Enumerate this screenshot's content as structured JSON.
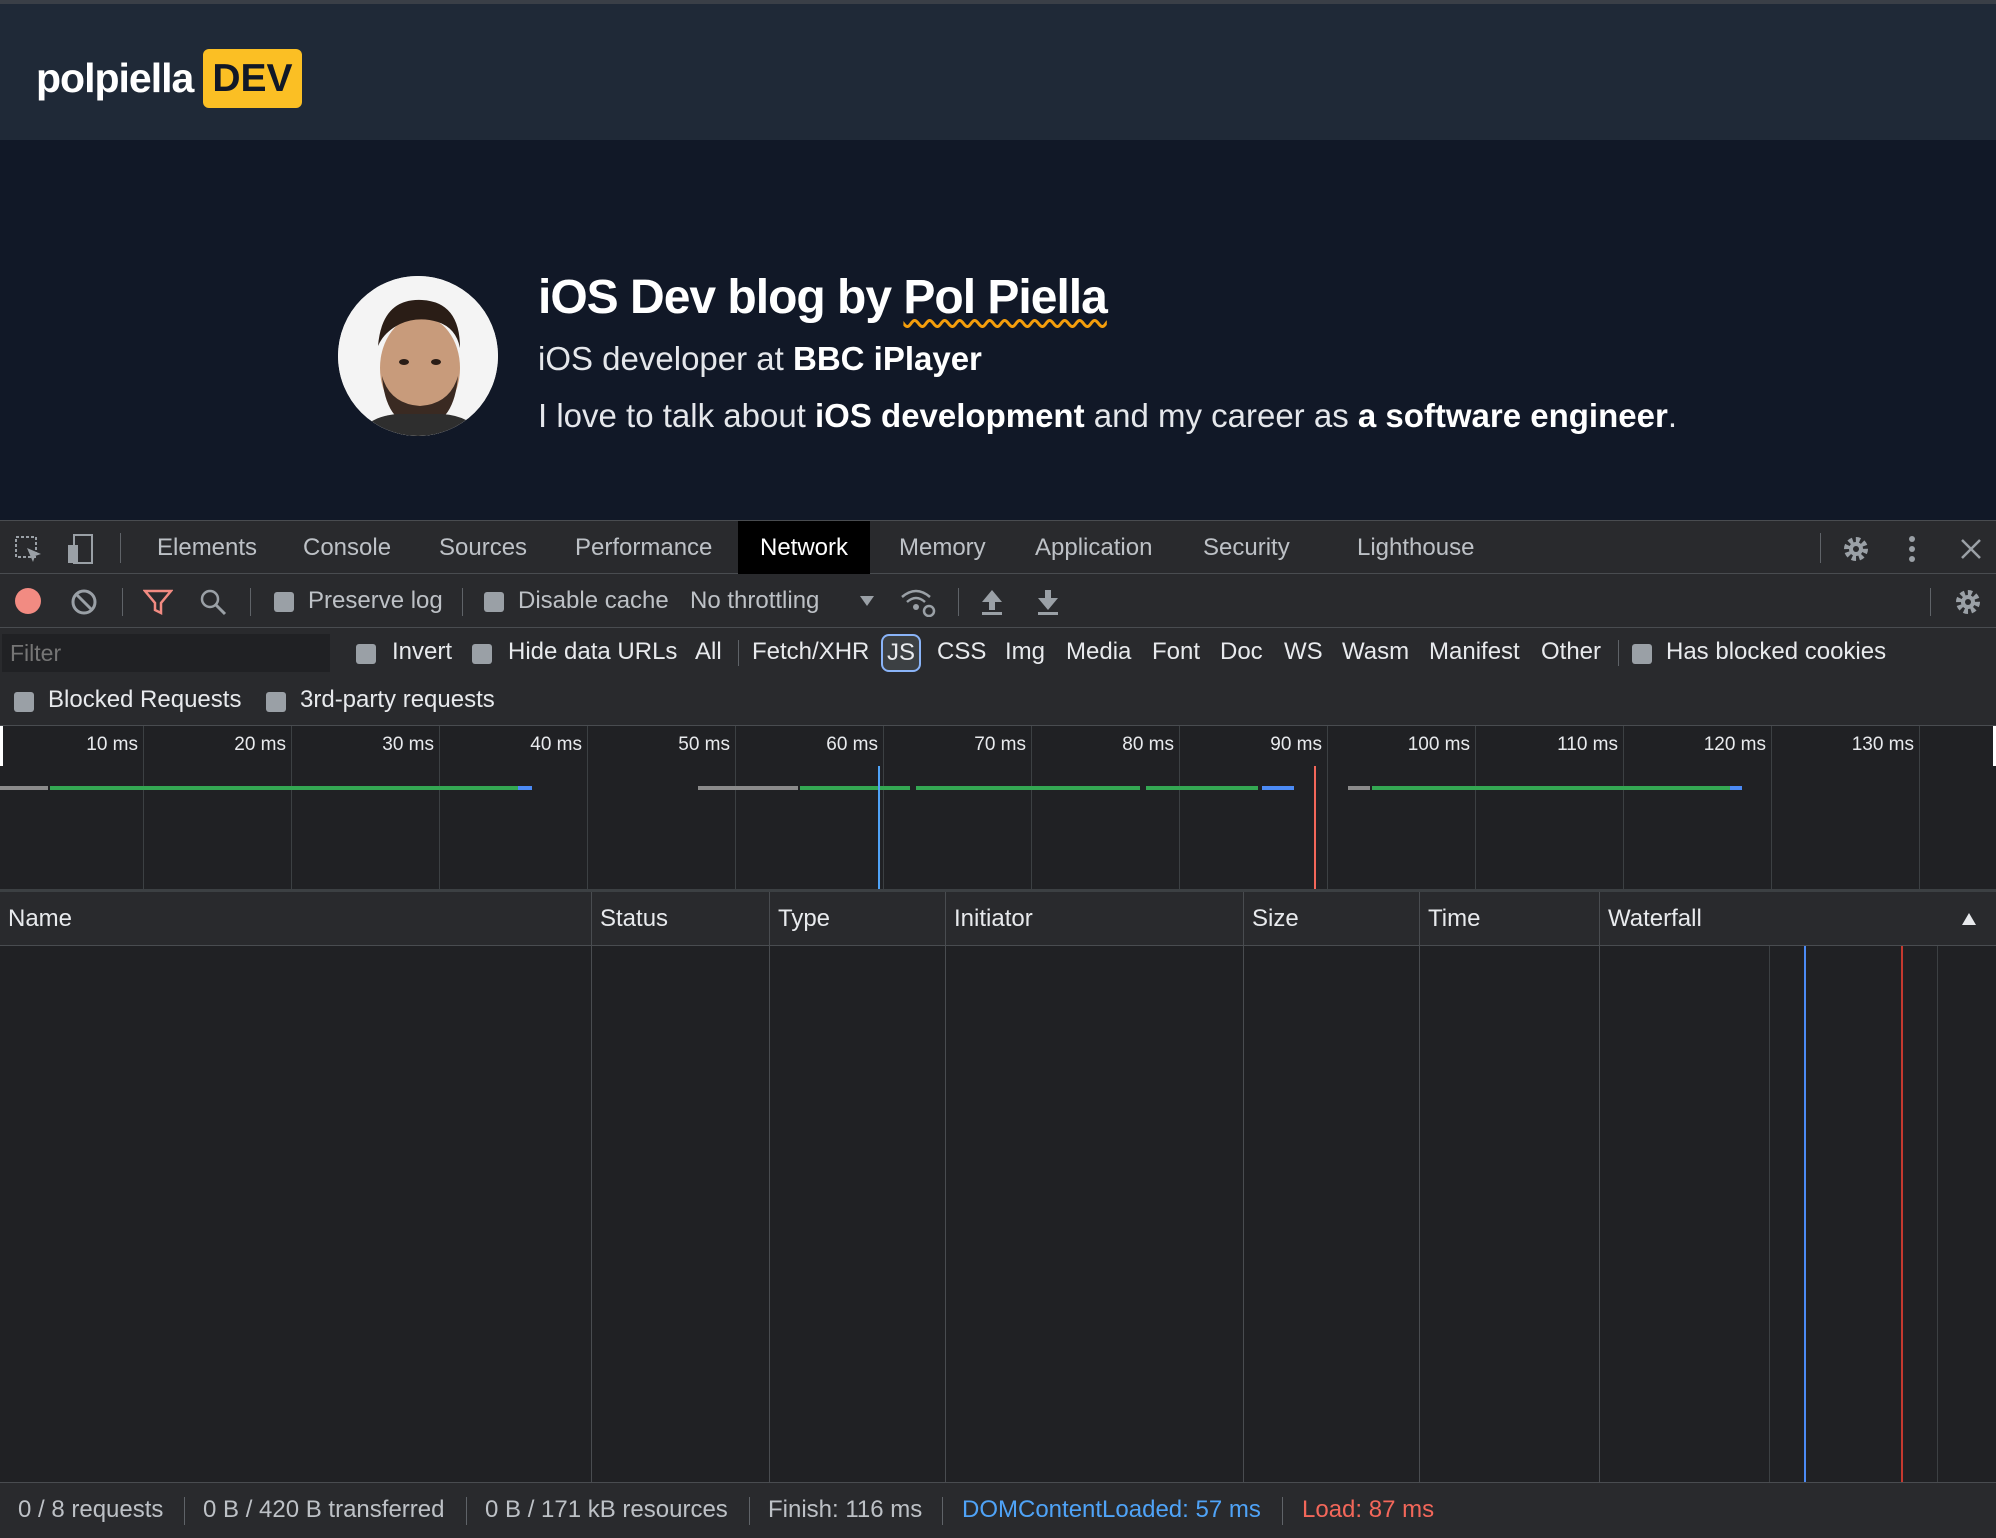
{
  "site": {
    "logo_text": "polpiella",
    "logo_badge": "DEV",
    "title_prefix": "iOS Dev blog by ",
    "title_name": "Pol Piella",
    "sub_prefix": "iOS developer at ",
    "sub_strong": "BBC iPlayer",
    "desc_1": "I love to talk about ",
    "desc_2": "iOS development",
    "desc_3": " and my career as ",
    "desc_4": "a software engineer",
    "desc_5": "."
  },
  "devtools": {
    "tabs": [
      "Elements",
      "Console",
      "Sources",
      "Performance",
      "Network",
      "Memory",
      "Application",
      "Security",
      "Lighthouse"
    ],
    "active_tab": "Network",
    "toolbar": {
      "preserve_log": "Preserve log",
      "disable_cache": "Disable cache",
      "throttling": "No throttling"
    },
    "filter": {
      "placeholder": "Filter",
      "invert": "Invert",
      "hide_data_urls": "Hide data URLs",
      "types": [
        "All",
        "Fetch/XHR",
        "JS",
        "CSS",
        "Img",
        "Media",
        "Font",
        "Doc",
        "WS",
        "Wasm",
        "Manifest",
        "Other"
      ],
      "selected_type": "JS",
      "has_blocked_cookies": "Has blocked cookies",
      "blocked_requests": "Blocked Requests",
      "third_party": "3rd-party requests"
    },
    "overview_ticks": [
      "10 ms",
      "20 ms",
      "30 ms",
      "40 ms",
      "50 ms",
      "60 ms",
      "70 ms",
      "80 ms",
      "90 ms",
      "100 ms",
      "110 ms",
      "120 ms",
      "130 ms"
    ],
    "columns": [
      "Name",
      "Status",
      "Type",
      "Initiator",
      "Size",
      "Time",
      "Waterfall"
    ],
    "status_bar": {
      "requests": "0 / 8 requests",
      "transferred": "0 B / 420 B transferred",
      "resources": "0 B / 171 kB resources",
      "finish": "Finish: 116 ms",
      "dcl": "DOMContentLoaded: 57 ms",
      "load": "Load: 87 ms"
    },
    "colors": {
      "dcl": "#4fa3f7",
      "load": "#f3675a",
      "record": "#f28b82",
      "accent": "#8ab4f8"
    }
  }
}
